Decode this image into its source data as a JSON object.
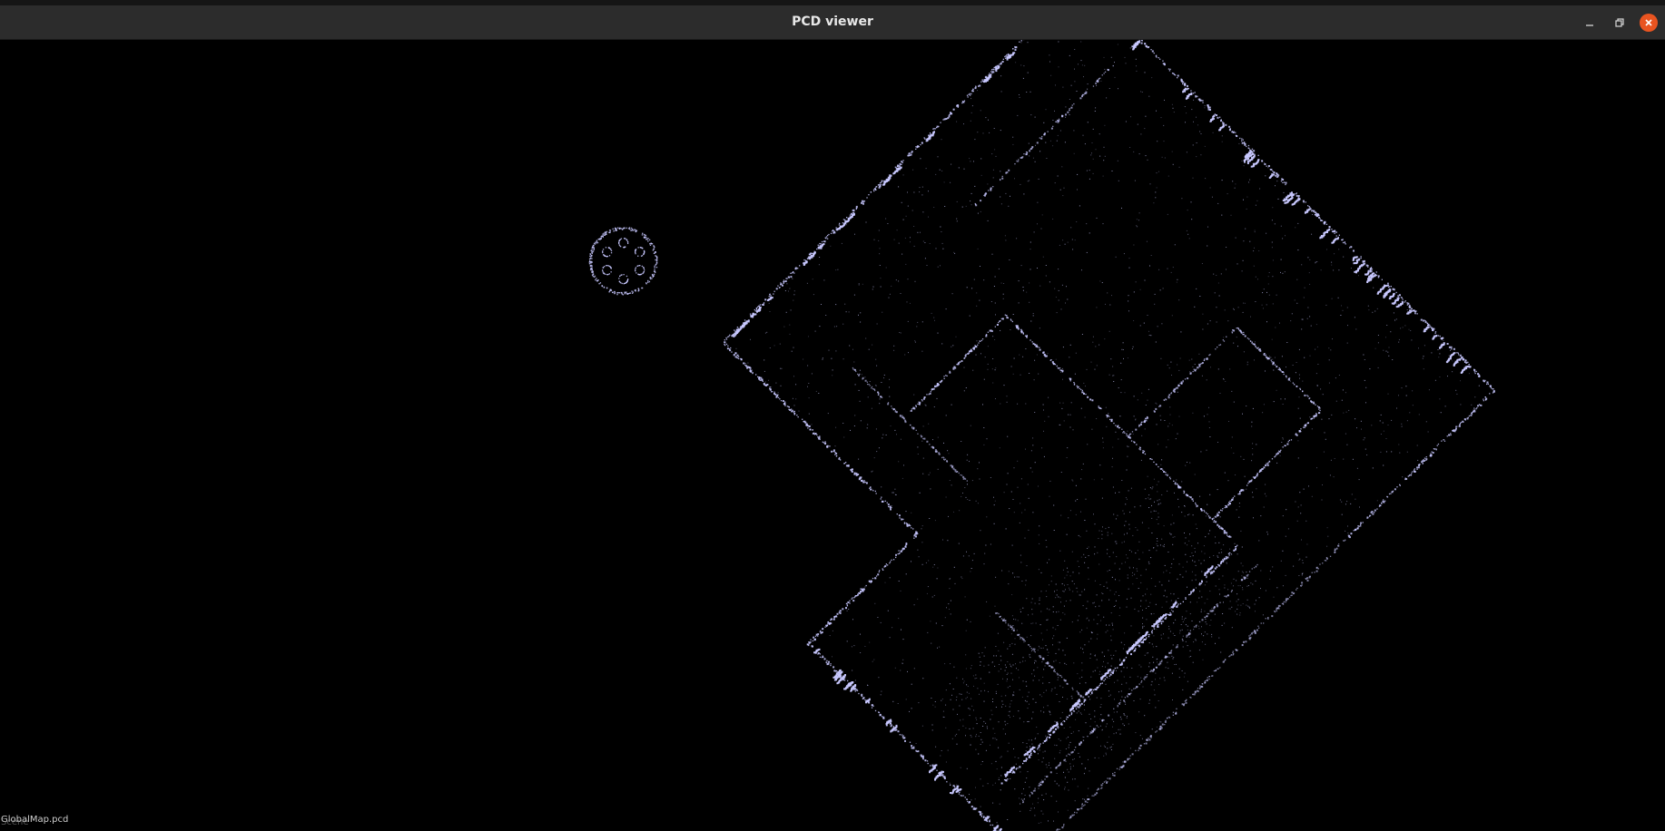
{
  "window": {
    "title": "PCD viewer",
    "controls": {
      "minimize_icon": "minimize-icon",
      "maximize_icon": "restore-icon",
      "close_icon": "close-icon"
    }
  },
  "viewer": {
    "background_color": "#000000",
    "point_color": "#c8c8ff",
    "overlay_text": "GlobalMap.pcd",
    "overlay_text_underlay": "Scene"
  },
  "colors": {
    "titlebar": "#2c2c2c",
    "close_button": "#e95420"
  }
}
